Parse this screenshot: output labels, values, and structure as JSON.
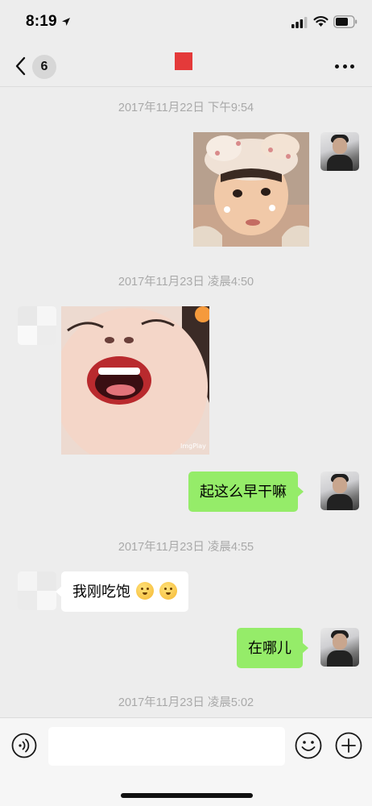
{
  "status_bar": {
    "time": "8:19",
    "location_icon": "location-arrow-icon",
    "signal_icon": "cellular-signal-icon",
    "wifi_icon": "wifi-icon",
    "battery_icon": "battery-icon"
  },
  "nav": {
    "back_icon": "chevron-left-icon",
    "unread_count": "6",
    "title_color": "#e43a3a",
    "more_icon": "more-dots-icon"
  },
  "messages": {
    "ts1": "2017年11月22日 下午9:54",
    "ts2": "2017年11月23日 凌晨4:50",
    "ts3": "2017年11月23日 凌晨4:55",
    "ts4": "2017年11月23日 凌晨5:02",
    "text1": "起这么早干嘛",
    "text2": "我刚吃饱",
    "text3": "在哪儿",
    "photo2_watermark": "ImgPlay"
  },
  "input_bar": {
    "placeholder": "",
    "voice_icon": "voice-input-icon",
    "emoji_icon": "emoji-icon",
    "plus_icon": "plus-circle-icon"
  },
  "colors": {
    "background": "#ededed",
    "self_bubble": "#95ec69",
    "other_bubble": "#ffffff",
    "timestamp_text": "#a9a9a9"
  }
}
